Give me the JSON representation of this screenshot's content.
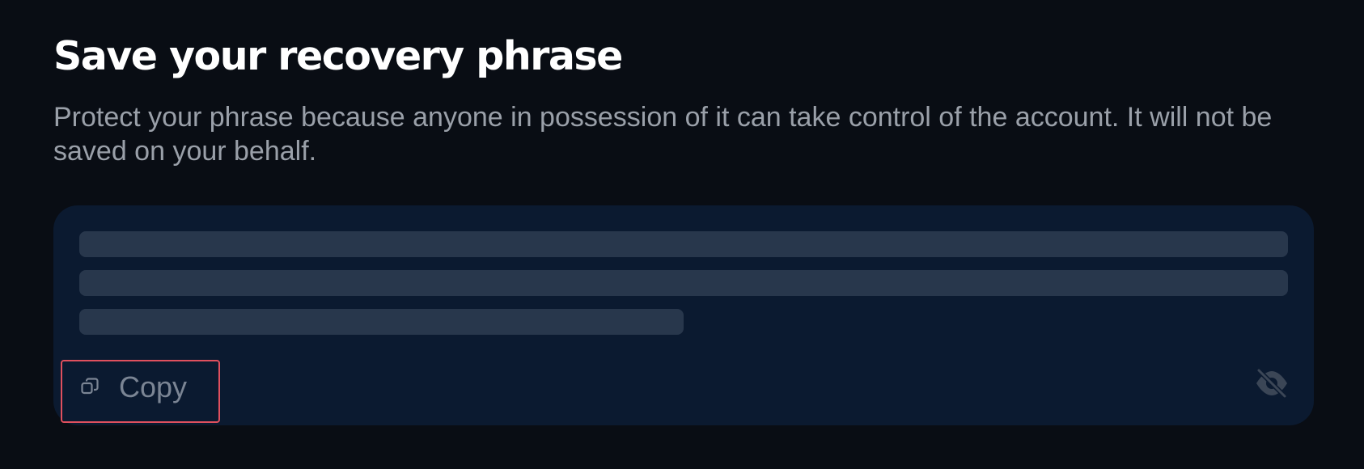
{
  "header": {
    "title": "Save your recovery phrase",
    "description": "Protect your phrase because anyone in possession of it can take control of the account. It will not be saved on your behalf."
  },
  "phrase_card": {
    "copy_label": "Copy",
    "copy_icon": "copy-icon",
    "visibility_icon": "eye-off-icon"
  },
  "colors": {
    "background": "#090d14",
    "card": "#0b1a30",
    "skeleton": "#28374c",
    "highlight_border": "#e0505e"
  }
}
